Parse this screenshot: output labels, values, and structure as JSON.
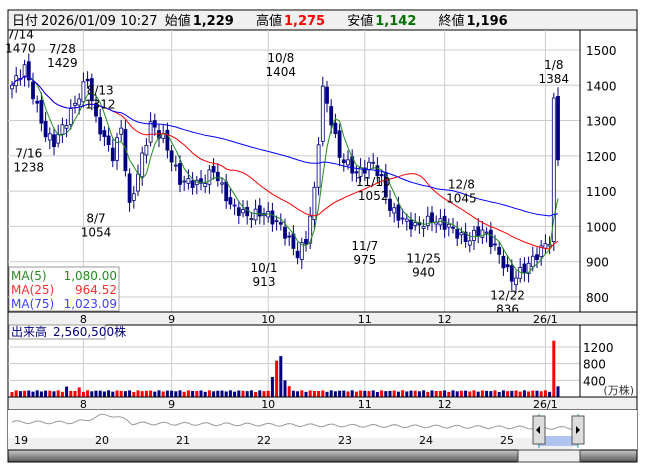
{
  "header": {
    "date_label": "日付",
    "datetime": "2026/01/09 10:27",
    "open_label": "始値",
    "open": "1,229",
    "high_label": "高値",
    "high": "1,275",
    "low_label": "安値",
    "low": "1,142",
    "close_label": "終値",
    "close": "1,196"
  },
  "legend": {
    "ma5_label": "MA(5)",
    "ma5": "1,080.00",
    "ma25_label": "MA(25)",
    "ma25": "964.52",
    "ma75_label": "MA(75)",
    "ma75": "1,023.09"
  },
  "volume_legend": {
    "label": "出来高",
    "value": "2,560,500株"
  },
  "volume_unit": "(万株)",
  "colors": {
    "up": "#ff0000",
    "down": "#000080",
    "ma5": "#228b22",
    "ma25": "#ff0000",
    "ma75": "#0000ff",
    "grid": "#cccccc"
  },
  "chart_data": {
    "type": "candlestick",
    "price_axis": {
      "ylim": [
        760,
        1560
      ],
      "ticks": [
        "1500",
        "1400",
        "1300",
        "1200",
        "1100",
        "1000",
        "900",
        "800"
      ]
    },
    "volume_axis": {
      "ylim": [
        0,
        1500
      ],
      "ticks": [
        "1200",
        "800",
        "400"
      ]
    },
    "month_labels": [
      {
        "day": 17,
        "label": "8"
      },
      {
        "day": 38,
        "label": "9"
      },
      {
        "day": 61,
        "label": "10"
      },
      {
        "day": 84,
        "label": "11"
      },
      {
        "day": 103,
        "label": "12"
      },
      {
        "day": 127,
        "label": "26/1"
      }
    ],
    "total_days": 131,
    "close_keypoints": [
      [
        0,
        1400
      ],
      [
        3,
        1450
      ],
      [
        8,
        1260
      ],
      [
        10,
        1238
      ],
      [
        13,
        1300
      ],
      [
        18,
        1420
      ],
      [
        20,
        1300
      ],
      [
        24,
        1200
      ],
      [
        26,
        1280
      ],
      [
        28,
        1054
      ],
      [
        30,
        1150
      ],
      [
        33,
        1290
      ],
      [
        36,
        1250
      ],
      [
        40,
        1130
      ],
      [
        45,
        1120
      ],
      [
        48,
        1160
      ],
      [
        52,
        1060
      ],
      [
        56,
        1030
      ],
      [
        60,
        1040
      ],
      [
        64,
        1000
      ],
      [
        68,
        920
      ],
      [
        70,
        960
      ],
      [
        72,
        1100
      ],
      [
        74,
        1390
      ],
      [
        76,
        1300
      ],
      [
        78,
        1200
      ],
      [
        82,
        1150
      ],
      [
        86,
        1180
      ],
      [
        88,
        1130
      ],
      [
        90,
        1050
      ],
      [
        93,
        1020
      ],
      [
        96,
        1000
      ],
      [
        100,
        1020
      ],
      [
        104,
        1000
      ],
      [
        108,
        960
      ],
      [
        112,
        990
      ],
      [
        115,
        940
      ],
      [
        119,
        850
      ],
      [
        122,
        880
      ],
      [
        125,
        920
      ],
      [
        127,
        950
      ],
      [
        128,
        960
      ],
      [
        129,
        1350
      ],
      [
        130,
        1196
      ]
    ],
    "volume_base": 120,
    "volume_spikes": [
      [
        13,
        250
      ],
      [
        16,
        230
      ],
      [
        62,
        480
      ],
      [
        63,
        870
      ],
      [
        64,
        980
      ],
      [
        65,
        400
      ],
      [
        66,
        260
      ],
      [
        129,
        1350
      ],
      [
        130,
        256
      ]
    ],
    "annotations": [
      {
        "day": 2,
        "price": 1470,
        "date": "7/14",
        "value": "1470",
        "pos": "above"
      },
      {
        "day": 12,
        "price": 1429,
        "date": "7/28",
        "value": "1429",
        "pos": "above"
      },
      {
        "day": 21,
        "price": 1312,
        "date": "8/13",
        "value": "1312",
        "pos": "above"
      },
      {
        "day": 4,
        "price": 1238,
        "date": "7/16",
        "value": "1238",
        "pos": "below"
      },
      {
        "day": 20,
        "price": 1054,
        "date": "8/7",
        "value": "1054",
        "pos": "below"
      },
      {
        "day": 60,
        "price": 913,
        "date": "10/1",
        "value": "913",
        "pos": "below"
      },
      {
        "day": 64,
        "price": 1404,
        "date": "10/8",
        "value": "1404",
        "pos": "above"
      },
      {
        "day": 86,
        "price": 1052,
        "date": "11/10",
        "value": "1052",
        "pos": "above"
      },
      {
        "day": 84,
        "price": 975,
        "date": "11/7",
        "value": "975",
        "pos": "below"
      },
      {
        "day": 98,
        "price": 940,
        "date": "11/25",
        "value": "940",
        "pos": "below"
      },
      {
        "day": 107,
        "price": 1045,
        "date": "12/8",
        "value": "1045",
        "pos": "above"
      },
      {
        "day": 118,
        "price": 836,
        "date": "12/22",
        "value": "836",
        "pos": "below"
      },
      {
        "day": 129,
        "price": 1384,
        "date": "1/8",
        "value": "1384",
        "pos": "above"
      }
    ],
    "navigator_labels": [
      "19",
      "20",
      "21",
      "22",
      "23",
      "24",
      "25"
    ]
  }
}
